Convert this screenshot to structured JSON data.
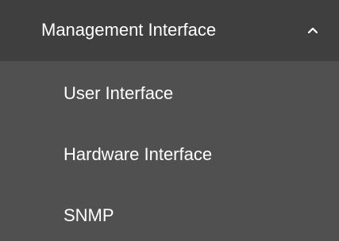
{
  "menu": {
    "header": {
      "label": "Management Interface",
      "expanded": true,
      "icon": "chevron-up-icon"
    },
    "items": [
      {
        "label": "User Interface"
      },
      {
        "label": "Hardware Interface"
      },
      {
        "label": "SNMP"
      }
    ]
  },
  "colors": {
    "header_background": "#3f3f3f",
    "submenu_background": "#505050",
    "text": "#ffffff"
  }
}
